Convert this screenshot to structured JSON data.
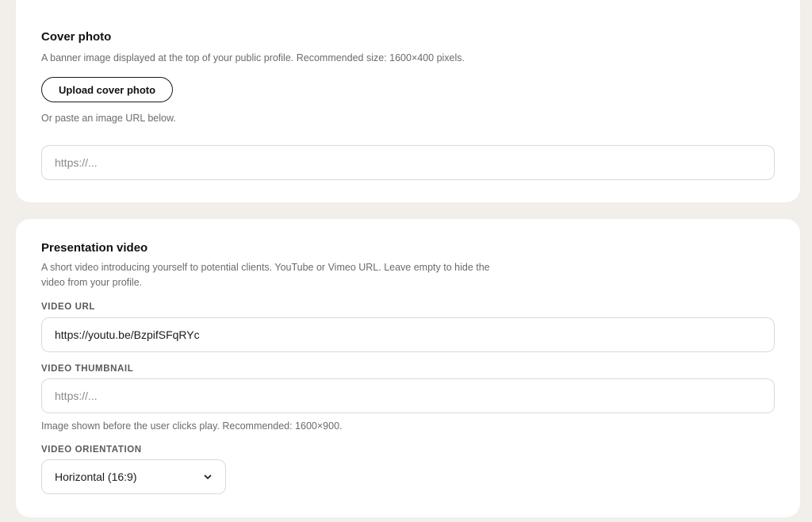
{
  "cover": {
    "title": "Cover photo",
    "description": "A banner image displayed at the top of your public profile. Recommended size: 1600×400 pixels.",
    "upload_button": "Upload cover photo",
    "paste_hint": "Or paste an image URL below.",
    "url_input": {
      "value": "",
      "placeholder": "https://..."
    }
  },
  "video": {
    "title": "Presentation video",
    "description_line1": "A short video introducing yourself to potential clients. YouTube or Vimeo URL. Leave empty to hide the",
    "description_line2": "video from your profile.",
    "url_label": "VIDEO URL",
    "url_input": {
      "value": "https://youtu.be/BzpifSFqRYc",
      "placeholder": ""
    },
    "thumbnail_label": "VIDEO THUMBNAIL",
    "thumbnail_input": {
      "value": "",
      "placeholder": "https://..."
    },
    "thumbnail_hint": "Image shown before the user clicks play. Recommended: 1600×900.",
    "orientation_label": "VIDEO ORIENTATION",
    "orientation_selected": "Horizontal (16:9)",
    "orientation_icon": "chevron-down-icon"
  }
}
